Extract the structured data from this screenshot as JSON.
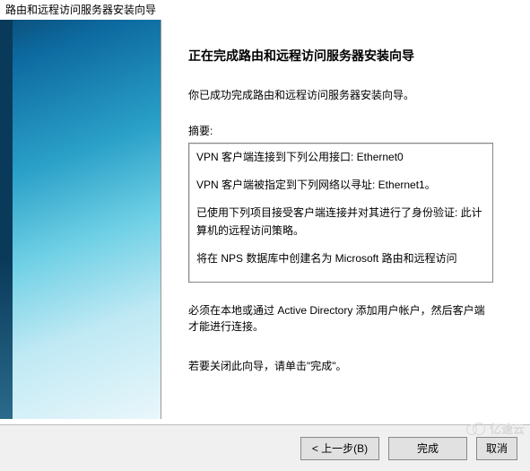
{
  "window": {
    "title": "路由和远程访问服务器安装向导"
  },
  "content": {
    "heading": "正在完成路由和远程访问服务器安装向导",
    "intro": "你已成功完成路由和远程访问服务器安装向导。",
    "summary_label": "摘要:",
    "summary_items": [
      "VPN 客户端连接到下列公用接口: Ethernet0",
      "VPN 客户端被指定到下列网络以寻址: Ethernet1。",
      "已使用下列项目接受客户端连接并对其进行了身份验证: 此计算机的远程访问策略。",
      "将在 NPS 数据库中创建名为 Microsoft 路由和远程访问"
    ],
    "note": "必须在本地或通过 Active Directory 添加用户帐户，然后客户端才能进行连接。",
    "close_note": "若要关闭此向导，请单击\"完成\"。"
  },
  "buttons": {
    "back": "< 上一步(B)",
    "finish": "完成",
    "cancel": "取消"
  },
  "watermark": "亿速云"
}
